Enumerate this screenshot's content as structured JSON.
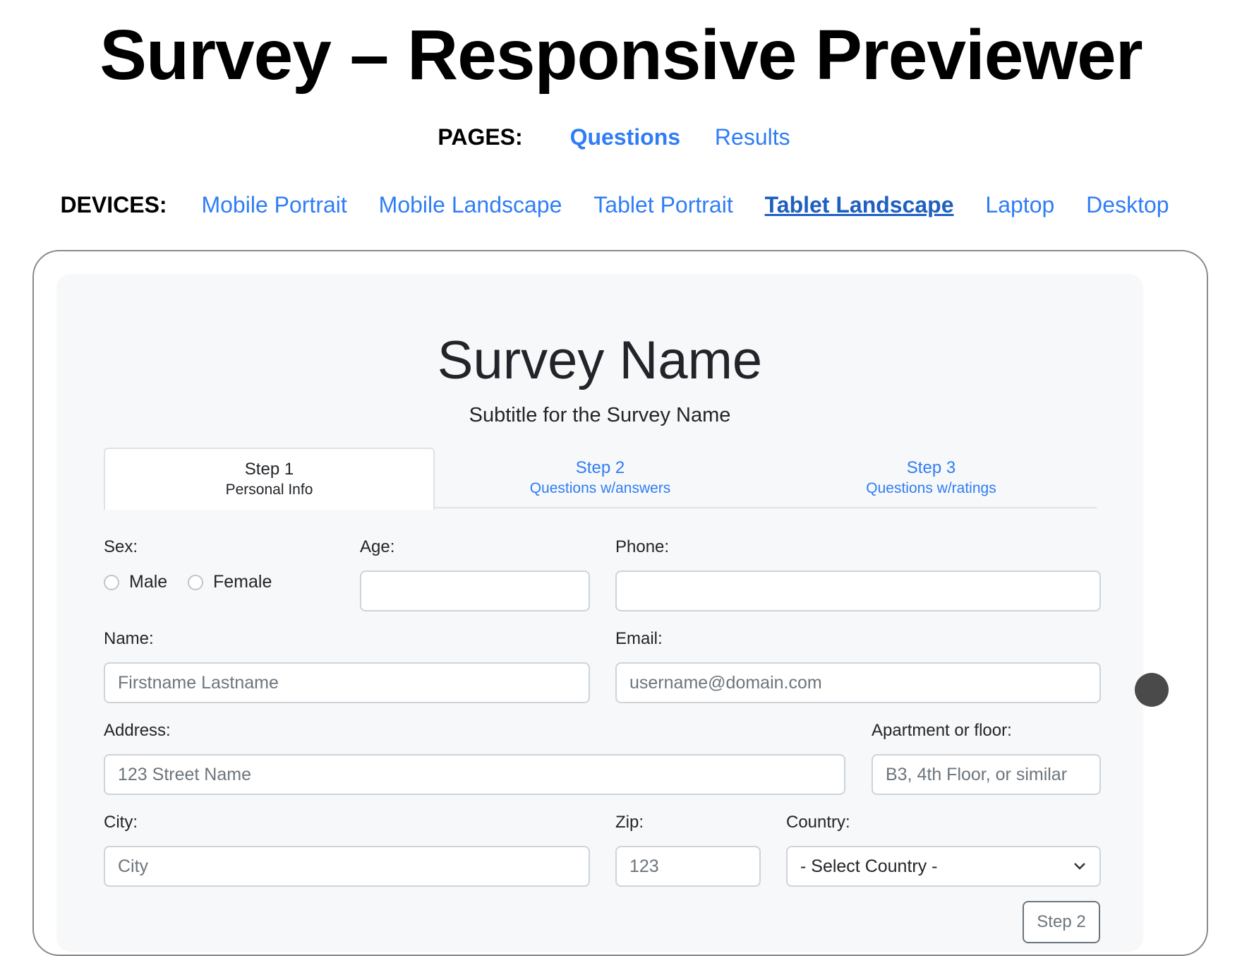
{
  "header": {
    "title": "Survey – Responsive Previewer",
    "pages_label": "PAGES:",
    "pages": [
      "Questions",
      "Results"
    ],
    "devices_label": "DEVICES:",
    "devices": [
      "Mobile Portrait",
      "Mobile Landscape",
      "Tablet Portrait",
      "Tablet Landscape",
      "Laptop",
      "Desktop"
    ],
    "current_device": "Tablet Landscape"
  },
  "survey": {
    "name": "Survey Name",
    "subtitle": "Subtitle for the Survey Name",
    "tabs": [
      {
        "step": "Step 1",
        "sub": "Personal Info"
      },
      {
        "step": "Step 2",
        "sub": "Questions w/answers"
      },
      {
        "step": "Step 3",
        "sub": "Questions w/ratings"
      }
    ]
  },
  "form": {
    "sex_label": "Sex:",
    "male": "Male",
    "female": "Female",
    "age_label": "Age:",
    "phone_label": "Phone:",
    "name_label": "Name:",
    "name_placeholder": "Firstname Lastname",
    "email_label": "Email:",
    "email_placeholder": "username@domain.com",
    "address_label": "Address:",
    "address_placeholder": "123 Street Name",
    "apt_label": "Apartment or floor:",
    "apt_placeholder": "B3, 4th Floor, or similar",
    "city_label": "City:",
    "city_placeholder": "City",
    "zip_label": "Zip:",
    "zip_placeholder": "123",
    "country_label": "Country:",
    "country_selected": "- Select Country -",
    "next_button": "Step 2"
  },
  "colors": {
    "link": "#2f7df6",
    "link_current": "#1e5fc0",
    "screen_bg": "#f7f8f9"
  }
}
